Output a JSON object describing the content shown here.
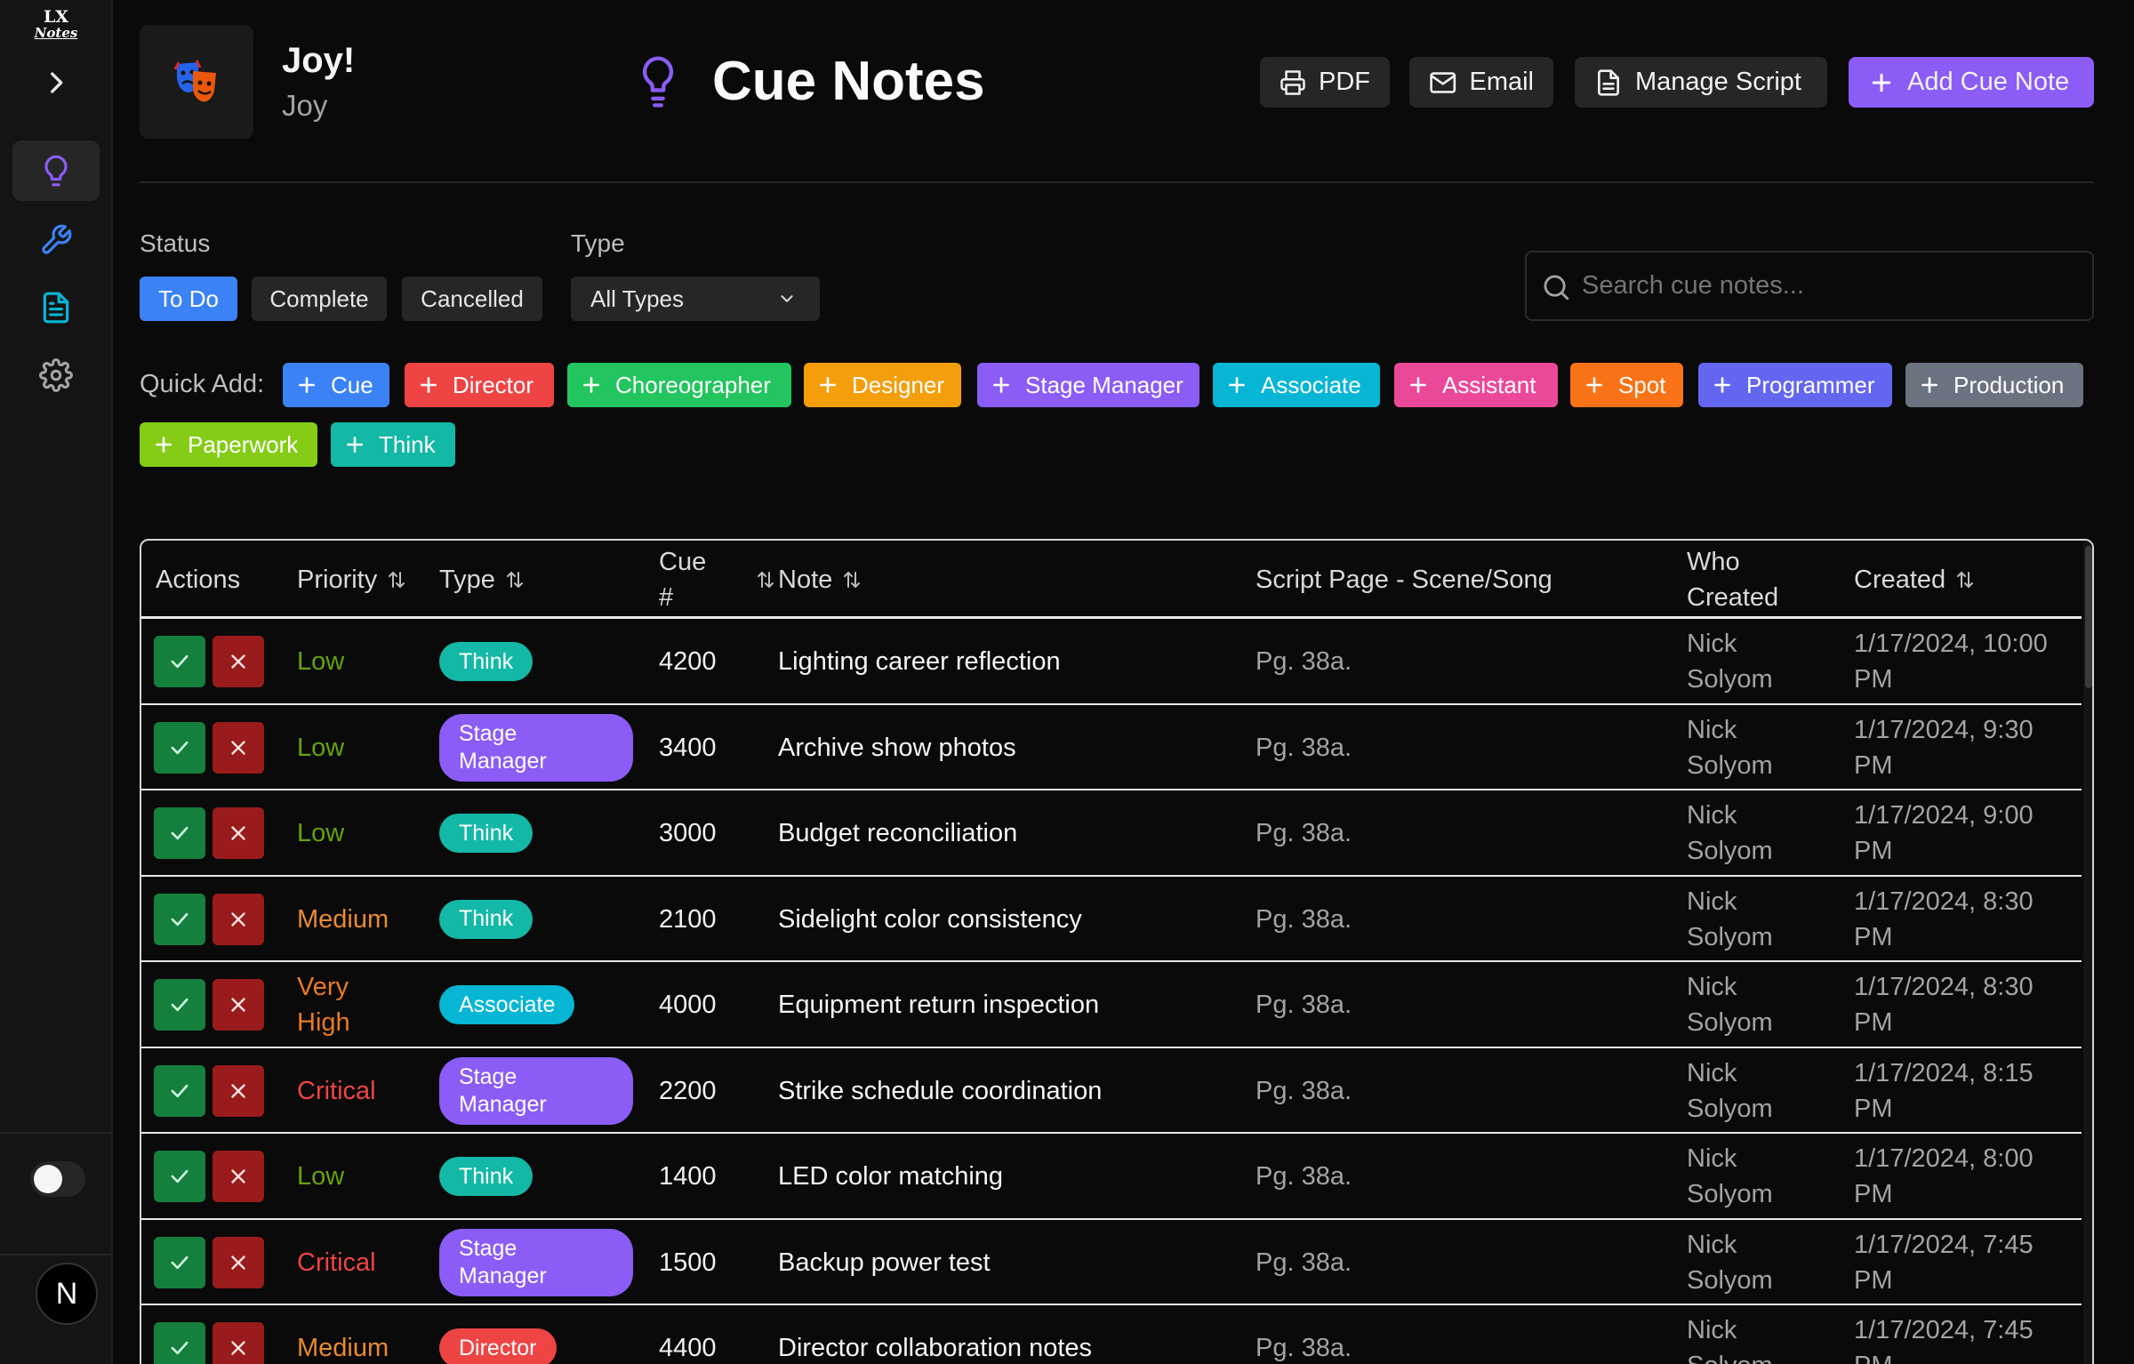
{
  "sidebar": {
    "logo_text": "LX Notes",
    "items": [
      {
        "name": "cue-notes",
        "icon": "lightbulb-icon",
        "color": "#8b5cf6"
      },
      {
        "name": "work-notes",
        "icon": "wrench-icon",
        "color": "#3b82f6"
      },
      {
        "name": "production-notes",
        "icon": "document-icon",
        "color": "#06b6d4"
      },
      {
        "name": "settings",
        "icon": "gear-icon",
        "color": "#a3a3a3"
      }
    ],
    "avatar_letter": "N"
  },
  "header": {
    "production_name": "Joy!",
    "production_sub": "Joy",
    "page_title": "Cue Notes",
    "buttons": {
      "pdf": "PDF",
      "email": "Email",
      "manage_script": "Manage Script",
      "add_cue_note": "Add Cue Note"
    },
    "accent": "#8b5cf6"
  },
  "filters": {
    "status_label": "Status",
    "status_options": [
      "To Do",
      "Complete",
      "Cancelled"
    ],
    "status_selected": "To Do",
    "type_label": "Type",
    "type_selected": "All Types",
    "search_placeholder": "Search cue notes..."
  },
  "quick_add": {
    "label": "Quick Add:",
    "items": [
      {
        "label": "Cue",
        "color": "#3b82f6"
      },
      {
        "label": "Director",
        "color": "#ef4444"
      },
      {
        "label": "Choreographer",
        "color": "#22c55e"
      },
      {
        "label": "Designer",
        "color": "#f59e0b"
      },
      {
        "label": "Stage Manager",
        "color": "#8b5cf6"
      },
      {
        "label": "Associate",
        "color": "#06b6d4"
      },
      {
        "label": "Assistant",
        "color": "#ec4899"
      },
      {
        "label": "Spot",
        "color": "#f97316"
      },
      {
        "label": "Programmer",
        "color": "#6366f1"
      },
      {
        "label": "Production",
        "color": "#6b7280"
      },
      {
        "label": "Paperwork",
        "color": "#84cc16"
      },
      {
        "label": "Think",
        "color": "#14b8a6"
      }
    ]
  },
  "table": {
    "headers": {
      "actions": "Actions",
      "priority": "Priority",
      "type": "Type",
      "cue_line1": "Cue",
      "cue_line2": "#",
      "note": "Note",
      "script_page": "Script Page - Scene/Song",
      "who_line1": "Who",
      "who_line2": "Created",
      "created": "Created"
    },
    "rows": [
      {
        "priority": "Low",
        "priority_color": "#65a30d",
        "type_l1": "Think",
        "type_l2": "",
        "type_color": "#14b8a6",
        "cue": "4200",
        "note": "Lighting career reflection",
        "page": "Pg. 38a.",
        "who1": "Nick",
        "who2": "Solyom",
        "c1": "1/17/2024, 10:00",
        "c2": "PM"
      },
      {
        "priority": "Low",
        "priority_color": "#65a30d",
        "type_l1": "Stage",
        "type_l2": "Manager",
        "type_color": "#8b5cf6",
        "cue": "3400",
        "note": "Archive show photos",
        "page": "Pg. 38a.",
        "who1": "Nick",
        "who2": "Solyom",
        "c1": "1/17/2024, 9:30",
        "c2": "PM"
      },
      {
        "priority": "Low",
        "priority_color": "#65a30d",
        "type_l1": "Think",
        "type_l2": "",
        "type_color": "#14b8a6",
        "cue": "3000",
        "note": "Budget reconciliation",
        "page": "Pg. 38a.",
        "who1": "Nick",
        "who2": "Solyom",
        "c1": "1/17/2024, 9:00",
        "c2": "PM"
      },
      {
        "priority": "Medium",
        "priority_color": "#ea8a2e",
        "type_l1": "Think",
        "type_l2": "",
        "type_color": "#14b8a6",
        "cue": "2100",
        "note": "Sidelight color consistency",
        "page": "Pg. 38a.",
        "who1": "Nick",
        "who2": "Solyom",
        "c1": "1/17/2024, 8:30",
        "c2": "PM"
      },
      {
        "priority": "Very",
        "priority2": "High",
        "priority_color": "#ea7a22",
        "type_l1": "Associate",
        "type_l2": "",
        "type_color": "#06b6d4",
        "cue": "4000",
        "note": "Equipment return inspection",
        "page": "Pg. 38a.",
        "who1": "Nick",
        "who2": "Solyom",
        "c1": "1/17/2024, 8:30",
        "c2": "PM"
      },
      {
        "priority": "Critical",
        "priority_color": "#ef4444",
        "type_l1": "Stage",
        "type_l2": "Manager",
        "type_color": "#8b5cf6",
        "cue": "2200",
        "note": "Strike schedule coordination",
        "page": "Pg. 38a.",
        "who1": "Nick",
        "who2": "Solyom",
        "c1": "1/17/2024, 8:15",
        "c2": "PM"
      },
      {
        "priority": "Low",
        "priority_color": "#65a30d",
        "type_l1": "Think",
        "type_l2": "",
        "type_color": "#14b8a6",
        "cue": "1400",
        "note": "LED color matching",
        "page": "Pg. 38a.",
        "who1": "Nick",
        "who2": "Solyom",
        "c1": "1/17/2024, 8:00",
        "c2": "PM"
      },
      {
        "priority": "Critical",
        "priority_color": "#ef4444",
        "type_l1": "Stage",
        "type_l2": "Manager",
        "type_color": "#8b5cf6",
        "cue": "1500",
        "note": "Backup power test",
        "page": "Pg. 38a.",
        "who1": "Nick",
        "who2": "Solyom",
        "c1": "1/17/2024, 7:45",
        "c2": "PM"
      },
      {
        "priority": "Medium",
        "priority_color": "#ea8a2e",
        "type_l1": "Director",
        "type_l2": "",
        "type_color": "#ef4444",
        "cue": "4400",
        "note": "Director collaboration notes",
        "page": "Pg. 38a.",
        "who1": "Nick",
        "who2": "Solyom",
        "c1": "1/17/2024, 7:45",
        "c2": "PM"
      }
    ]
  }
}
